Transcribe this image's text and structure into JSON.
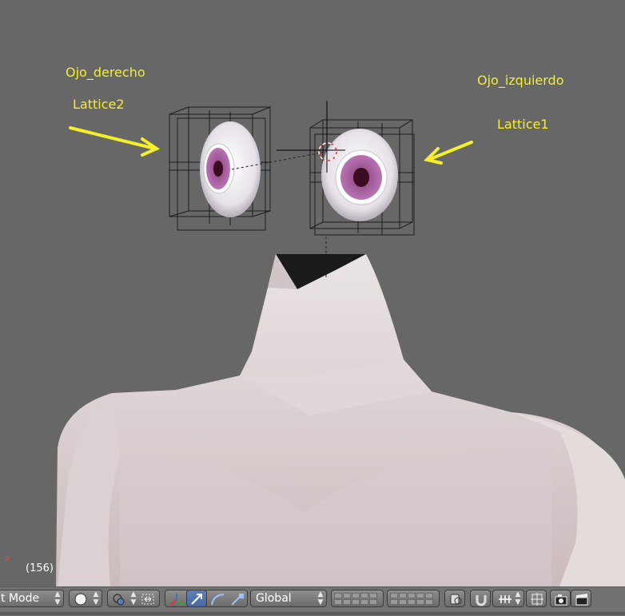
{
  "viewport": {
    "annotations": {
      "right_eye_name": "Ojo_derecho",
      "right_eye_lattice": "Lattice2",
      "left_eye_name": "Ojo_izquierdo",
      "left_eye_lattice": "Lattice1"
    },
    "frame_counter": "(156)",
    "axis_label": "x",
    "annotation_color": "#f5ef2a"
  },
  "header": {
    "mode_label": "t Mode",
    "shading_icon": "solid-sphere-icon",
    "pivot_icon": "pivot-point-icon",
    "manipulator_icons": [
      "transform-axes-icon",
      "translate-arrow-icon",
      "rotate-arc-icon",
      "scale-handle-icon"
    ],
    "orientation_label": "Global",
    "layers_icon": "layers-grid-icon",
    "proportional_icon": "proportional-edit-icon",
    "snap_icon": "magnet-icon",
    "snap_element_icon": "snap-increment-icon",
    "snap_target_icon": "snap-target-icon",
    "render_still_icon": "camera-icon",
    "render_anim_icon": "clapperboard-icon",
    "accent_color": "#5d7fb8"
  }
}
